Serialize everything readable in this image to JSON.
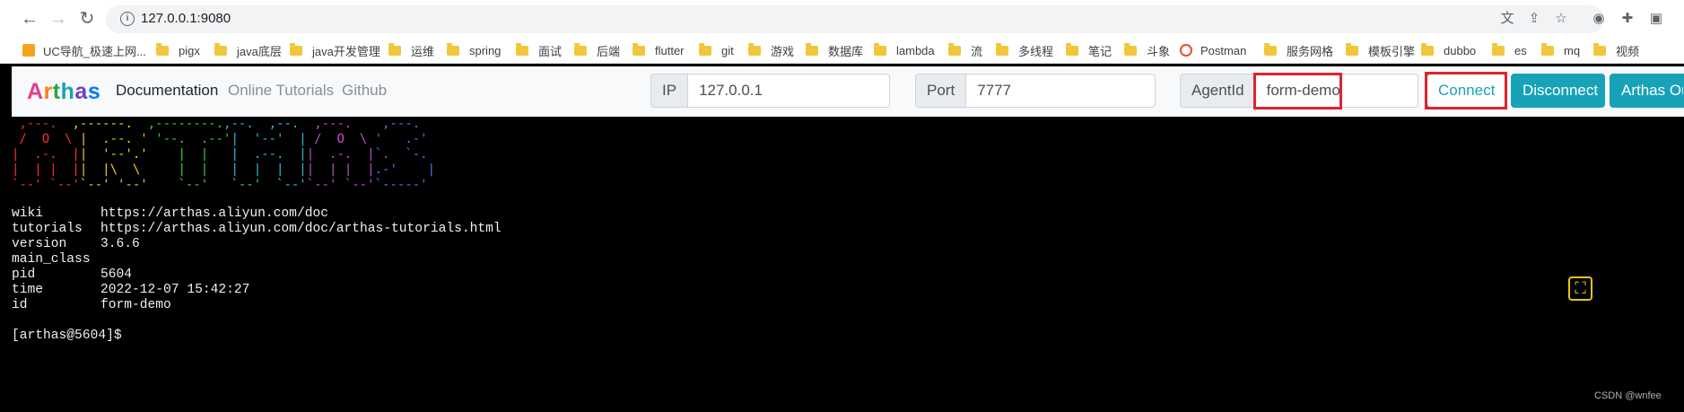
{
  "browser": {
    "url": "127.0.0.1:9080",
    "bookmarks": [
      "UC导航_极速上网...",
      "pigx",
      "java底层",
      "java开发管理",
      "运维",
      "spring",
      "面试",
      "后端",
      "flutter",
      "git",
      "游戏",
      "数据库",
      "lambda",
      "流",
      "多线程",
      "笔记",
      "斗象",
      "Postman",
      "服务网格",
      "模板引擎",
      "dubbo",
      "es",
      "mq",
      "视频"
    ]
  },
  "nav": {
    "logo": [
      "A",
      "r",
      "t",
      "h",
      "a",
      "s"
    ],
    "links": [
      "Documentation",
      "Online Tutorials",
      "Github"
    ],
    "ip_label": "IP",
    "ip_value": "127.0.0.1",
    "port_label": "Port",
    "port_value": "7777",
    "agent_label": "AgentId",
    "agent_value": "form-demo",
    "connect": "Connect",
    "disconnect": "Disconnect",
    "arthas_output": "Arthas Ou"
  },
  "terminal": {
    "banner": [
      [
        [
          " ,---.  ",
          "red"
        ],
        [
          ",------.  ",
          "yel"
        ],
        [
          ",--------.",
          "grn"
        ],
        [
          ",--.  ,--.  ",
          "cyn"
        ],
        [
          ",---.   ",
          "mag"
        ],
        [
          " ,---.",
          "blu"
        ]
      ],
      [
        [
          " /  O  \\ ",
          "red"
        ],
        [
          "|  .--. ' ",
          "yel"
        ],
        [
          "'--.  .--'",
          "grn"
        ],
        [
          "|  '--'  | ",
          "cyn"
        ],
        [
          "/  O  \\ ",
          "mag"
        ],
        [
          "'   .-'",
          "blu"
        ]
      ],
      [
        [
          "|  .-.  |",
          "red"
        ],
        [
          "|  '--'.' ",
          "yel"
        ],
        [
          "   |  |   ",
          "grn"
        ],
        [
          "|  .--.  |",
          "cyn"
        ],
        [
          "|  .-.  |",
          "mag"
        ],
        [
          "`.  `-.",
          "blu"
        ]
      ],
      [
        [
          "|  | |  |",
          "red"
        ],
        [
          "|  |\\  \\  ",
          "yel"
        ],
        [
          "   |  |   ",
          "grn"
        ],
        [
          "|  |  |  |",
          "cyn"
        ],
        [
          "|  | |  |",
          "mag"
        ],
        [
          ".-'    |",
          "blu"
        ]
      ],
      [
        [
          "`--' `--'",
          "red"
        ],
        [
          "`--' '--' ",
          "yel"
        ],
        [
          "   `--'   ",
          "grn"
        ],
        [
          "`--'  `--'",
          "cyn"
        ],
        [
          "`--' `--'",
          "mag"
        ],
        [
          "`-----'",
          "blu"
        ]
      ]
    ],
    "info": [
      {
        "key": "wiki",
        "value": "https://arthas.aliyun.com/doc"
      },
      {
        "key": "tutorials",
        "value": "https://arthas.aliyun.com/doc/arthas-tutorials.html"
      },
      {
        "key": "version",
        "value": "3.6.6"
      },
      {
        "key": "main_class",
        "value": ""
      },
      {
        "key": "pid",
        "value": "5604"
      },
      {
        "key": "time",
        "value": "2022-12-07 15:42:27"
      },
      {
        "key": "id",
        "value": "form-demo"
      }
    ],
    "prompt": "[arthas@5604]$"
  },
  "watermark": "CSDN @wnfee",
  "colors": {
    "accent": "#17a2b8",
    "highlight": "#e0232c",
    "terminal_bg": "#000000",
    "fullscreen": "#e8c417"
  }
}
